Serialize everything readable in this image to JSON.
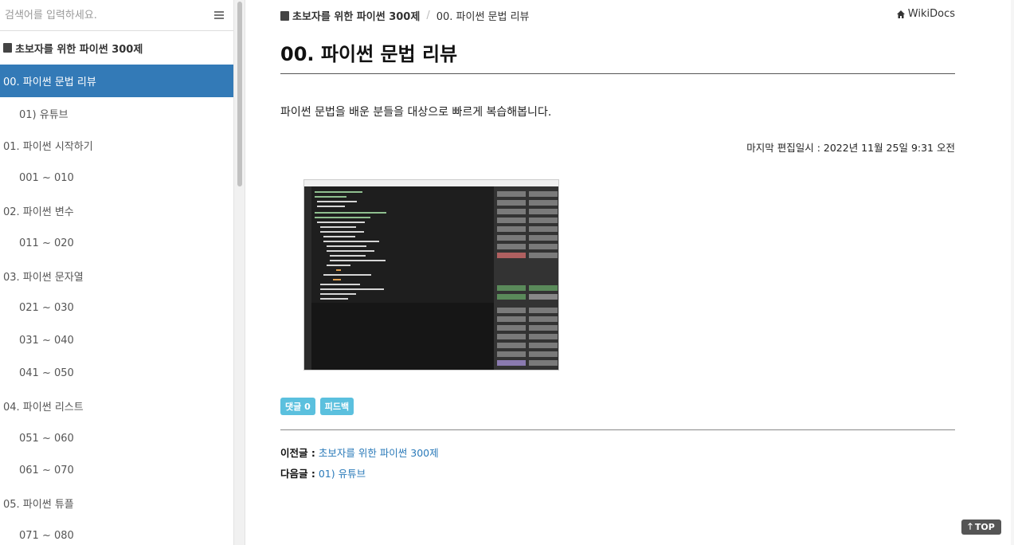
{
  "sidebar": {
    "search_placeholder": "검색어를 입력하세요.",
    "book_title": "초보자를 위한 파이썬 300제",
    "items": [
      {
        "label": "00. 파이썬 문법 리뷰",
        "level": 0,
        "active": true
      },
      {
        "label": "01) 유튜브",
        "level": 1
      },
      {
        "label": "01. 파이썬 시작하기",
        "level": 0
      },
      {
        "label": "001 ~ 010",
        "level": 1
      },
      {
        "label": "02. 파이썬 변수",
        "level": 0
      },
      {
        "label": "011 ~ 020",
        "level": 1
      },
      {
        "label": "03. 파이썬 문자열",
        "level": 0
      },
      {
        "label": "021 ~ 030",
        "level": 1
      },
      {
        "label": "031 ~ 040",
        "level": 1
      },
      {
        "label": "041 ~ 050",
        "level": 1
      },
      {
        "label": "04. 파이썬 리스트",
        "level": 0
      },
      {
        "label": "051 ~ 060",
        "level": 1
      },
      {
        "label": "061 ~ 070",
        "level": 1
      },
      {
        "label": "05. 파이썬 튜플",
        "level": 0
      },
      {
        "label": "071 ~ 080",
        "level": 1
      }
    ]
  },
  "breadcrumb": {
    "book": "초보자를 위한 파이썬 300제",
    "separator": "/",
    "current": "00. 파이썬 문법 리뷰"
  },
  "header": {
    "site_link": "WikiDocs"
  },
  "page": {
    "title": "00. 파이썬 문법 리뷰",
    "intro": "파이썬 문법을 배운 분들을 대상으로 빠르게 복습해봅니다.",
    "last_edited": "마지막 편집일시 : 2022년 11월 25일 9:31 오전",
    "comments_badge": "댓글 0",
    "feedback_badge": "피드백",
    "prev_label": "이전글 :",
    "prev_link": "초보자를 위한 파이썬 300제",
    "next_label": "다음글 :",
    "next_link": "01) 유튜브"
  },
  "top_button": "TOP",
  "colors": {
    "active_nav": "#337ab7",
    "badge": "#5bc0de",
    "link": "#2a7ab9"
  }
}
